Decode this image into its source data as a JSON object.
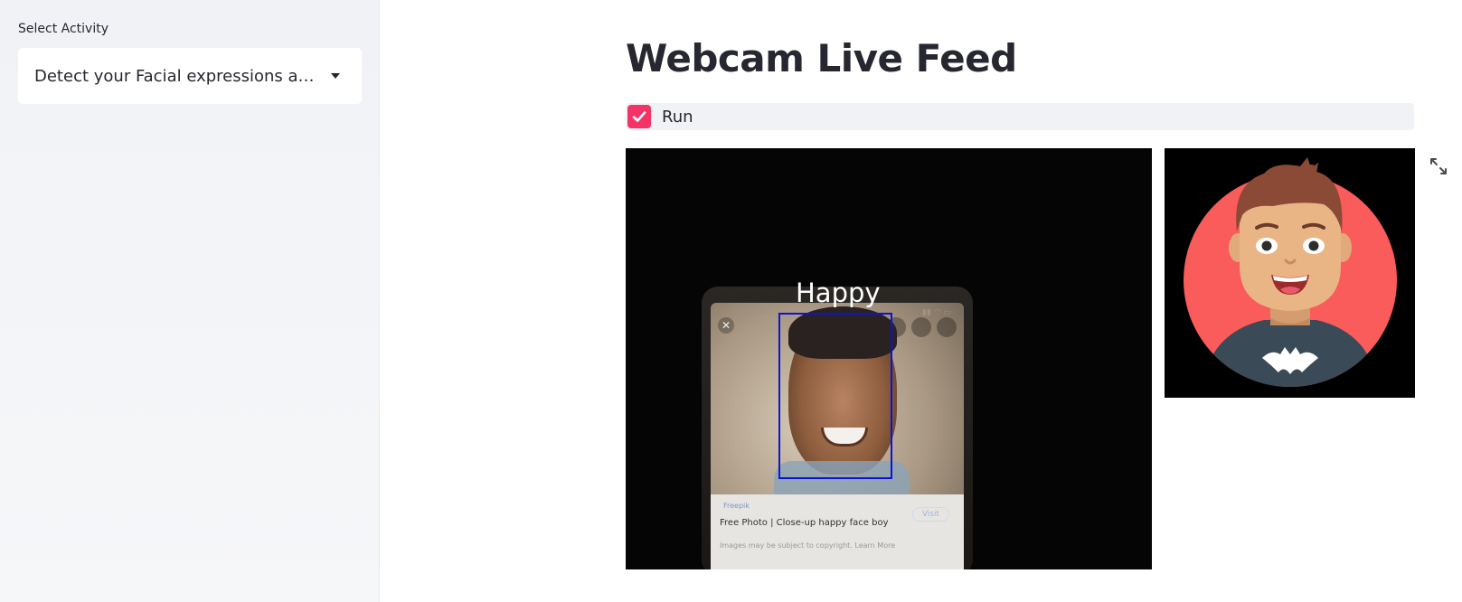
{
  "sidebar": {
    "label": "Select Activity",
    "select": {
      "value": "Detect your Facial expressions an..."
    }
  },
  "main": {
    "title": "Webcam Live Feed",
    "run_checkbox": {
      "label": "Run",
      "checked": true
    },
    "webcam": {
      "detection_label": "Happy",
      "phone_status_time": "9:13 PM",
      "phone_source": "Freepik",
      "phone_visit": "Visit",
      "phone_caption": "Free Photo | Close-up happy face boy",
      "phone_note": "Images may be subject to copyright. Learn More"
    },
    "avatar": {
      "icon": "happy-boy-avatar"
    },
    "expand_icon": "fullscreen-icon"
  },
  "colors": {
    "accent": "#f63366",
    "detect_box": "#0b14d8",
    "avatar_circle": "#fa5b5b",
    "sidebar_bg": "#f0f2f6"
  }
}
